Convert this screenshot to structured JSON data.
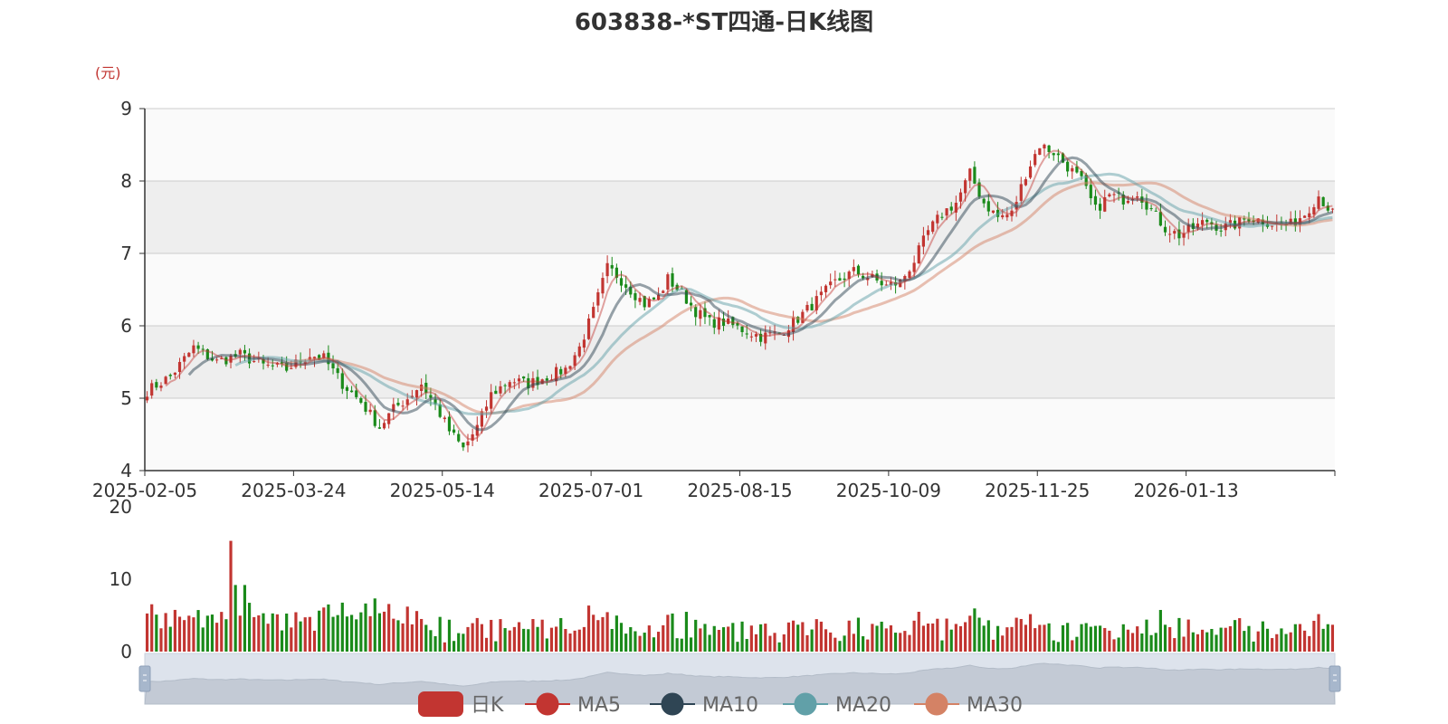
{
  "chart_data": [
    {
      "type": "candlestick",
      "title": "603838-*ST四通-日K线图",
      "ylabel": "(元)",
      "ylim": [
        4,
        9
      ],
      "yticks": [
        "4",
        "5",
        "6",
        "7",
        "8",
        "9"
      ],
      "xticks": [
        "2025-02-05",
        "2025-03-24",
        "2025-05-14",
        "2025-07-01",
        "2025-08-15",
        "2025-10-09",
        "2025-11-25",
        "2026-01-13"
      ],
      "grid": true,
      "legend": {
        "position": "bottom",
        "items": [
          {
            "label": "日K",
            "color": "#c23531",
            "shape": "roundRect"
          },
          {
            "label": "MA5",
            "color": "#c23531",
            "shape": "circle"
          },
          {
            "label": "MA10",
            "color": "#2f4554",
            "shape": "circle"
          },
          {
            "label": "MA20",
            "color": "#61a0a8",
            "shape": "circle"
          },
          {
            "label": "MA30",
            "color": "#d48265",
            "shape": "circle"
          }
        ]
      },
      "up_color": "#c23531",
      "down_color": "#1a8a1a",
      "close_anchors": [
        [
          0,
          5.1
        ],
        [
          5,
          5.3
        ],
        [
          10,
          5.7
        ],
        [
          15,
          5.5
        ],
        [
          20,
          5.6
        ],
        [
          25,
          5.45
        ],
        [
          30,
          5.4
        ],
        [
          35,
          5.6
        ],
        [
          38,
          5.55
        ],
        [
          42,
          5.2
        ],
        [
          46,
          4.95
        ],
        [
          50,
          4.6
        ],
        [
          53,
          4.85
        ],
        [
          56,
          5.0
        ],
        [
          59,
          5.2
        ],
        [
          62,
          4.9
        ],
        [
          65,
          4.55
        ],
        [
          68,
          4.3
        ],
        [
          71,
          4.6
        ],
        [
          74,
          5.05
        ],
        [
          78,
          5.25
        ],
        [
          82,
          5.2
        ],
        [
          86,
          5.3
        ],
        [
          90,
          5.4
        ],
        [
          93,
          5.7
        ],
        [
          96,
          6.2
        ],
        [
          99,
          6.8
        ],
        [
          101,
          6.7
        ],
        [
          104,
          6.5
        ],
        [
          107,
          6.3
        ],
        [
          110,
          6.4
        ],
        [
          112,
          6.65
        ],
        [
          115,
          6.45
        ],
        [
          118,
          6.2
        ],
        [
          121,
          6.05
        ],
        [
          124,
          6.05
        ],
        [
          128,
          5.95
        ],
        [
          132,
          5.85
        ],
        [
          136,
          5.9
        ],
        [
          140,
          6.1
        ],
        [
          144,
          6.35
        ],
        [
          148,
          6.6
        ],
        [
          152,
          6.75
        ],
        [
          156,
          6.65
        ],
        [
          159,
          6.55
        ],
        [
          162,
          6.6
        ],
        [
          165,
          6.9
        ],
        [
          168,
          7.3
        ],
        [
          171,
          7.55
        ],
        [
          174,
          7.7
        ],
        [
          177,
          8.1
        ],
        [
          180,
          7.7
        ],
        [
          183,
          7.5
        ],
        [
          186,
          7.55
        ],
        [
          189,
          8.1
        ],
        [
          192,
          8.5
        ],
        [
          195,
          8.4
        ],
        [
          198,
          8.2
        ],
        [
          201,
          8.0
        ],
        [
          204,
          7.6
        ],
        [
          207,
          7.8
        ],
        [
          210,
          7.75
        ],
        [
          213,
          7.85
        ],
        [
          216,
          7.6
        ],
        [
          219,
          7.35
        ],
        [
          222,
          7.25
        ],
        [
          225,
          7.35
        ],
        [
          228,
          7.45
        ],
        [
          231,
          7.35
        ],
        [
          234,
          7.4
        ],
        [
          237,
          7.5
        ],
        [
          240,
          7.45
        ],
        [
          243,
          7.4
        ],
        [
          246,
          7.4
        ],
        [
          249,
          7.55
        ],
        [
          252,
          7.8
        ],
        [
          255,
          7.55
        ]
      ],
      "volume": {
        "ylim": [
          0,
          20
        ],
        "yticks": [
          "0",
          "10",
          "20"
        ]
      },
      "datazoom": {
        "start": 0,
        "end": 100
      }
    }
  ]
}
